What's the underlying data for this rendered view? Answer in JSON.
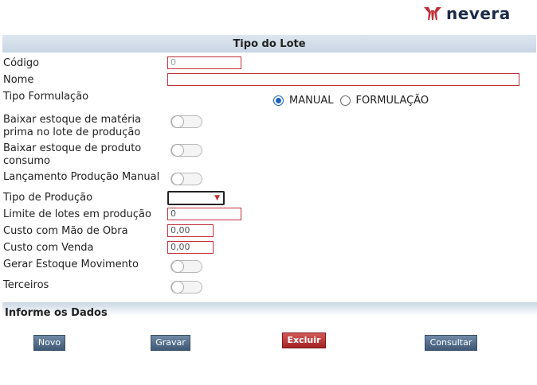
{
  "brand": {
    "name": "nevera"
  },
  "header": {
    "title": "Tipo do Lote"
  },
  "fields": {
    "codigo": {
      "label": "Código",
      "value": "0"
    },
    "nome": {
      "label": "Nome",
      "value": ""
    },
    "tipo_formulacao": {
      "label": "Tipo Formulação",
      "options": [
        "MANUAL",
        "FORMULAÇÃO"
      ],
      "selected": "MANUAL"
    },
    "baixar_materia": {
      "label_line1": "Baixar estoque de matéria",
      "label_line2": "prima no lote de produção",
      "on": false
    },
    "baixar_consumo": {
      "label_line1": "Baixar estoque de produto",
      "label_line2": "consumo",
      "on": false
    },
    "lancamento_manual": {
      "label": "Lançamento Produção Manual",
      "on": false
    },
    "tipo_producao": {
      "label": "Tipo de Produção",
      "value": ""
    },
    "limite_lotes": {
      "label": "Limite de lotes em produção",
      "value": "0"
    },
    "custo_mao_obra": {
      "label": "Custo com Mão de Obra",
      "value": "0,00"
    },
    "custo_venda": {
      "label": "Custo com Venda",
      "value": "0,00"
    },
    "gerar_estoque": {
      "label": "Gerar Estoque Movimento",
      "on": false
    },
    "terceiros": {
      "label": "Terceiros",
      "on": false
    }
  },
  "section": {
    "title": "Informe os Dados"
  },
  "buttons": {
    "novo": "Novo",
    "gravar": "Gravar",
    "excluir": "Excluir",
    "consultar": "Consultar"
  },
  "colors": {
    "accent_red": "#c0303a",
    "button_blue": "#4f6a89",
    "header_bg": "#d3dee9"
  }
}
